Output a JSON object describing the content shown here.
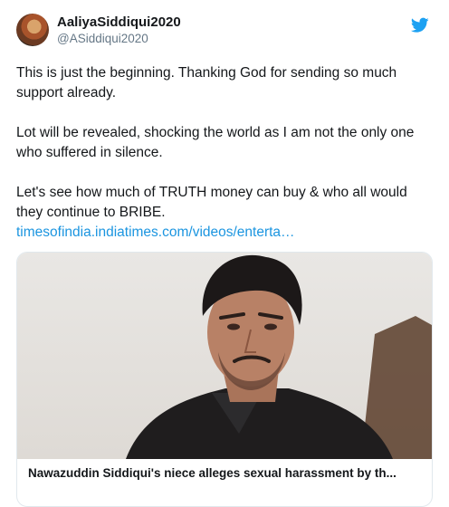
{
  "tweet": {
    "display_name": "AaliyaSiddiqui2020",
    "handle": "@ASiddiqui2020",
    "paragraphs": [
      "This is just the beginning. Thanking God for sending so much support already.",
      "Lot will be revealed, shocking the world as I am not the only one who suffered in silence.",
      "Let's see how much of TRUTH money can buy & who all would they continue to BRIBE."
    ],
    "link_text": "timesofindia.indiatimes.com/videos/enterta…"
  },
  "card": {
    "title": "Nawazuddin Siddiqui's niece alleges sexual harassment by th..."
  },
  "colors": {
    "twitter_blue": "#1da1f2",
    "link": "#1b95e0"
  },
  "icons": {
    "brand": "twitter-bird-icon"
  }
}
